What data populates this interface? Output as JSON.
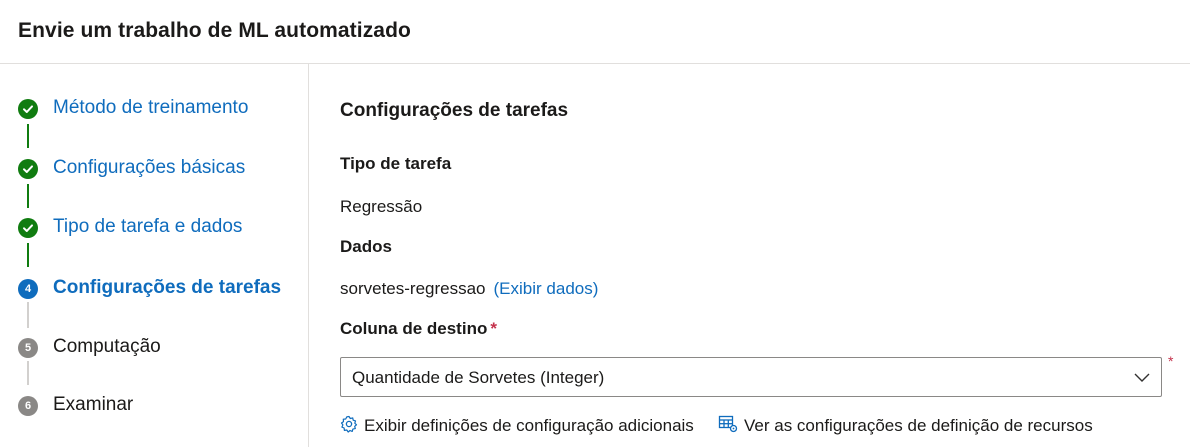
{
  "header": {
    "title": "Envie um trabalho de ML automatizado"
  },
  "colors": {
    "done": "#107c10",
    "current": "#0f6cbd",
    "pending": "#8a8886",
    "link": "#0f6cbd",
    "required": "#c4314b"
  },
  "steps": [
    {
      "label": "Método de treinamento",
      "state": "done",
      "icon": "checkmark-circle-icon"
    },
    {
      "label": "Configurações básicas",
      "state": "done",
      "icon": "checkmark-circle-icon"
    },
    {
      "label": "Tipo de tarefa e dados",
      "state": "done",
      "icon": "checkmark-circle-icon"
    },
    {
      "label": "Configurações de tarefas",
      "state": "current",
      "number": "4"
    },
    {
      "label": "Computação",
      "state": "pending",
      "number": "5"
    },
    {
      "label": "Examinar",
      "state": "pending",
      "number": "6"
    }
  ],
  "main": {
    "section_title": "Configurações de tarefas",
    "task_type_label": "Tipo de tarefa",
    "task_type_value": "Regressão",
    "data_label": "Dados",
    "data_value": "sorvetes-regressao",
    "view_data_link": "(Exibir dados)",
    "target_column_label": "Coluna de destino",
    "required_mark": "*",
    "target_column_value": "Quantidade de Sorvetes (Integer)",
    "additional_config_link": "Exibir definições de configuração adicionais",
    "featurization_link": "Ver as configurações de definição de recursos"
  }
}
